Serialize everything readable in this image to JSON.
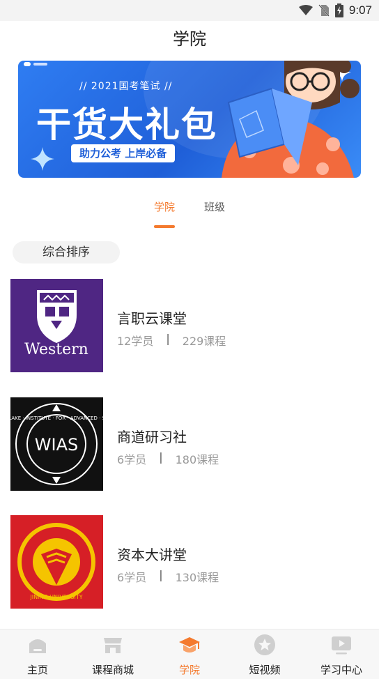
{
  "status_bar": {
    "time": "9:07"
  },
  "page": {
    "title": "学院"
  },
  "banner": {
    "subtitle": "// 2021国考笔试 //",
    "headline": "干货大礼包",
    "tag": "助力公考 上岸必备"
  },
  "tabs": [
    {
      "label": "学院",
      "active": true
    },
    {
      "label": "班级",
      "active": false
    }
  ],
  "sort": {
    "label": "综合排序"
  },
  "items": [
    {
      "name": "言职云课堂",
      "members": "12学员",
      "courses": "229课程",
      "logo_text": "Western"
    },
    {
      "name": "商道研习社",
      "members": "6学员",
      "courses": "180课程",
      "logo_text": "WIAS",
      "logo_ring": "WESTLAKE · INSTITUTE · FOR · ADVANCED · STUDY"
    },
    {
      "name": "资本大讲堂",
      "members": "6学员",
      "courses": "130课程",
      "logo_text": "JINING UNIVERSITY"
    }
  ],
  "separator": "|",
  "nav": [
    {
      "label": "主页",
      "icon": "home-icon",
      "active": false
    },
    {
      "label": "课程商城",
      "icon": "store-icon",
      "active": false
    },
    {
      "label": "学院",
      "icon": "graduation-cap-icon",
      "active": true
    },
    {
      "label": "短视频",
      "icon": "star-circle-icon",
      "active": false
    },
    {
      "label": "学习中心",
      "icon": "video-screen-icon",
      "active": false
    }
  ],
  "colors": {
    "accent": "#f47a2e",
    "banner_blue": "#1f5fd8"
  }
}
